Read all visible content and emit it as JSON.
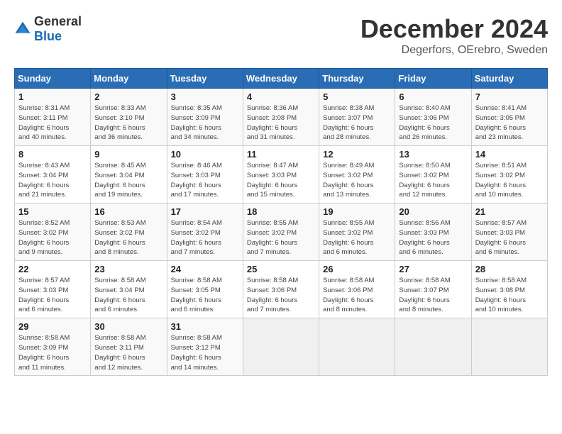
{
  "logo": {
    "text_general": "General",
    "text_blue": "Blue"
  },
  "title": "December 2024",
  "subtitle": "Degerfors, OErebro, Sweden",
  "days_of_week": [
    "Sunday",
    "Monday",
    "Tuesday",
    "Wednesday",
    "Thursday",
    "Friday",
    "Saturday"
  ],
  "weeks": [
    [
      {
        "day": "1",
        "info": "Sunrise: 8:31 AM\nSunset: 3:11 PM\nDaylight: 6 hours\nand 40 minutes."
      },
      {
        "day": "2",
        "info": "Sunrise: 8:33 AM\nSunset: 3:10 PM\nDaylight: 6 hours\nand 36 minutes."
      },
      {
        "day": "3",
        "info": "Sunrise: 8:35 AM\nSunset: 3:09 PM\nDaylight: 6 hours\nand 34 minutes."
      },
      {
        "day": "4",
        "info": "Sunrise: 8:36 AM\nSunset: 3:08 PM\nDaylight: 6 hours\nand 31 minutes."
      },
      {
        "day": "5",
        "info": "Sunrise: 8:38 AM\nSunset: 3:07 PM\nDaylight: 6 hours\nand 28 minutes."
      },
      {
        "day": "6",
        "info": "Sunrise: 8:40 AM\nSunset: 3:06 PM\nDaylight: 6 hours\nand 26 minutes."
      },
      {
        "day": "7",
        "info": "Sunrise: 8:41 AM\nSunset: 3:05 PM\nDaylight: 6 hours\nand 23 minutes."
      }
    ],
    [
      {
        "day": "8",
        "info": "Sunrise: 8:43 AM\nSunset: 3:04 PM\nDaylight: 6 hours\nand 21 minutes."
      },
      {
        "day": "9",
        "info": "Sunrise: 8:45 AM\nSunset: 3:04 PM\nDaylight: 6 hours\nand 19 minutes."
      },
      {
        "day": "10",
        "info": "Sunrise: 8:46 AM\nSunset: 3:03 PM\nDaylight: 6 hours\nand 17 minutes."
      },
      {
        "day": "11",
        "info": "Sunrise: 8:47 AM\nSunset: 3:03 PM\nDaylight: 6 hours\nand 15 minutes."
      },
      {
        "day": "12",
        "info": "Sunrise: 8:49 AM\nSunset: 3:02 PM\nDaylight: 6 hours\nand 13 minutes."
      },
      {
        "day": "13",
        "info": "Sunrise: 8:50 AM\nSunset: 3:02 PM\nDaylight: 6 hours\nand 12 minutes."
      },
      {
        "day": "14",
        "info": "Sunrise: 8:51 AM\nSunset: 3:02 PM\nDaylight: 6 hours\nand 10 minutes."
      }
    ],
    [
      {
        "day": "15",
        "info": "Sunrise: 8:52 AM\nSunset: 3:02 PM\nDaylight: 6 hours\nand 9 minutes."
      },
      {
        "day": "16",
        "info": "Sunrise: 8:53 AM\nSunset: 3:02 PM\nDaylight: 6 hours\nand 8 minutes."
      },
      {
        "day": "17",
        "info": "Sunrise: 8:54 AM\nSunset: 3:02 PM\nDaylight: 6 hours\nand 7 minutes."
      },
      {
        "day": "18",
        "info": "Sunrise: 8:55 AM\nSunset: 3:02 PM\nDaylight: 6 hours\nand 7 minutes."
      },
      {
        "day": "19",
        "info": "Sunrise: 8:55 AM\nSunset: 3:02 PM\nDaylight: 6 hours\nand 6 minutes."
      },
      {
        "day": "20",
        "info": "Sunrise: 8:56 AM\nSunset: 3:03 PM\nDaylight: 6 hours\nand 6 minutes."
      },
      {
        "day": "21",
        "info": "Sunrise: 8:57 AM\nSunset: 3:03 PM\nDaylight: 6 hours\nand 6 minutes."
      }
    ],
    [
      {
        "day": "22",
        "info": "Sunrise: 8:57 AM\nSunset: 3:03 PM\nDaylight: 6 hours\nand 6 minutes."
      },
      {
        "day": "23",
        "info": "Sunrise: 8:58 AM\nSunset: 3:04 PM\nDaylight: 6 hours\nand 6 minutes."
      },
      {
        "day": "24",
        "info": "Sunrise: 8:58 AM\nSunset: 3:05 PM\nDaylight: 6 hours\nand 6 minutes."
      },
      {
        "day": "25",
        "info": "Sunrise: 8:58 AM\nSunset: 3:06 PM\nDaylight: 6 hours\nand 7 minutes."
      },
      {
        "day": "26",
        "info": "Sunrise: 8:58 AM\nSunset: 3:06 PM\nDaylight: 6 hours\nand 8 minutes."
      },
      {
        "day": "27",
        "info": "Sunrise: 8:58 AM\nSunset: 3:07 PM\nDaylight: 6 hours\nand 8 minutes."
      },
      {
        "day": "28",
        "info": "Sunrise: 8:58 AM\nSunset: 3:08 PM\nDaylight: 6 hours\nand 10 minutes."
      }
    ],
    [
      {
        "day": "29",
        "info": "Sunrise: 8:58 AM\nSunset: 3:09 PM\nDaylight: 6 hours\nand 11 minutes."
      },
      {
        "day": "30",
        "info": "Sunrise: 8:58 AM\nSunset: 3:11 PM\nDaylight: 6 hours\nand 12 minutes."
      },
      {
        "day": "31",
        "info": "Sunrise: 8:58 AM\nSunset: 3:12 PM\nDaylight: 6 hours\nand 14 minutes."
      },
      {
        "day": "",
        "info": ""
      },
      {
        "day": "",
        "info": ""
      },
      {
        "day": "",
        "info": ""
      },
      {
        "day": "",
        "info": ""
      }
    ]
  ]
}
